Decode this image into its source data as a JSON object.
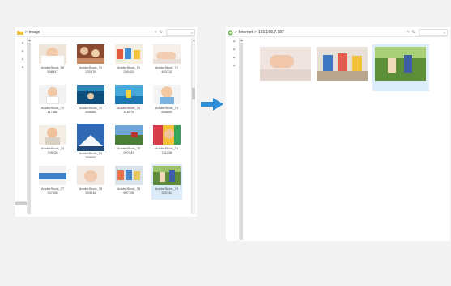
{
  "left_window": {
    "address": {
      "folder_icon": "folder-icon",
      "separator": ">",
      "path": "image",
      "dropdown": "˅",
      "refresh": "↻",
      "search_icon": "⌕"
    },
    "quick_access_pins": [
      "✶",
      "✶",
      "✶",
      "✶"
    ],
    "files": [
      {
        "line1": "AdobeStock_55",
        "line2": "558547",
        "selected": false
      },
      {
        "line1": "AdobeStock_71",
        "line2": "232578",
        "selected": false
      },
      {
        "line1": "AdobeStock_71",
        "line2": "250420",
        "selected": false
      },
      {
        "line1": "AdobeStock_71",
        "line2": "483732",
        "selected": false
      },
      {
        "line1": "AdobeStock_72",
        "line2": "117482",
        "selected": false
      },
      {
        "line1": "AdobeStock_72",
        "line2": "898485",
        "selected": false
      },
      {
        "line1": "AdobeStock_74",
        "line2": "316576",
        "selected": false
      },
      {
        "line1": "AdobeStock_74",
        "line2": "858689",
        "selected": false
      },
      {
        "line1": "AdobeStock_74",
        "line2": "709230",
        "selected": false
      },
      {
        "line1": "AdobeStock_74",
        "line2": "958882",
        "selected": false
      },
      {
        "line1": "AdobeStock_75",
        "line2": "097943",
        "selected": false
      },
      {
        "line1": "AdobeStock_76",
        "line2": "741258",
        "selected": false
      },
      {
        "line1": "AdobeStock_77",
        "line2": "337458",
        "selected": false
      },
      {
        "line1": "AdobeStock_78",
        "line2": "553616",
        "selected": false
      },
      {
        "line1": "AdobeStock_78",
        "line2": "697196",
        "selected": false
      },
      {
        "line1": "AdobeStock_79",
        "line2": "320742",
        "selected": true
      }
    ]
  },
  "right_window": {
    "address": {
      "network_icon": "network-icon",
      "separator1": ">",
      "location": "Internet",
      "separator2": ">",
      "host": "192.168.7.187",
      "dropdown": "˅",
      "refresh": "↻",
      "search_icon": "⌕"
    },
    "quick_access_pins": [
      "✶",
      "✶",
      "✶",
      "✶"
    ],
    "photos": [
      "sleeping-baby-photo",
      "children-on-sofa-photo",
      "kids-playing-outdoors-photo"
    ]
  },
  "colors": {
    "arrow": "#2e8fd8",
    "selection": "#dcecfb",
    "window": "#ffffff",
    "background": "#f2f2f2"
  }
}
